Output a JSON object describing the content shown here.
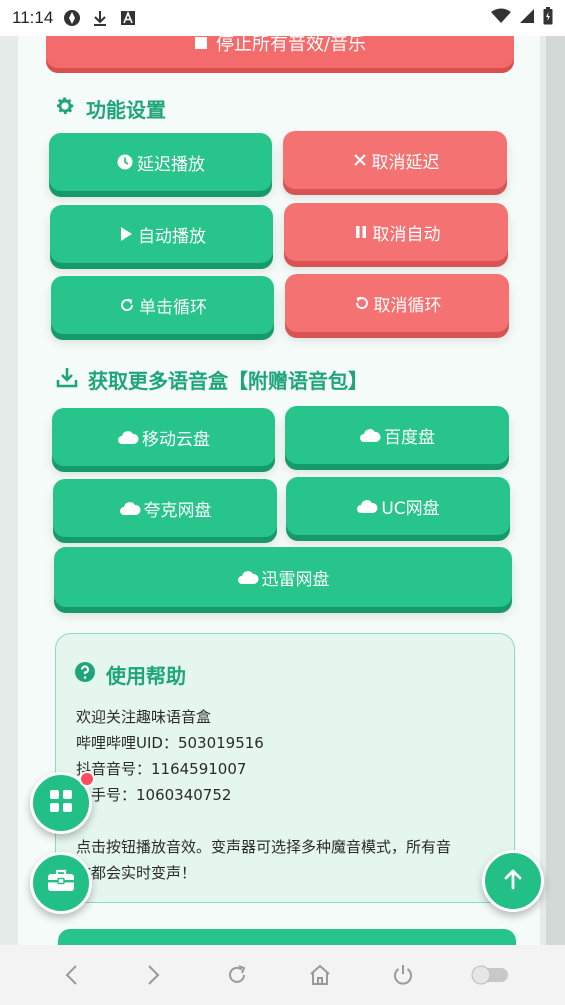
{
  "status_bar": {
    "time": "11:14"
  },
  "top_button": {
    "label": "停止所有音效/音乐"
  },
  "func_section": {
    "title": "功能设置",
    "buttons": [
      {
        "label": "延迟播放"
      },
      {
        "label": "取消延迟"
      },
      {
        "label": "自动播放"
      },
      {
        "label": "取消自动"
      },
      {
        "label": "单击循环"
      },
      {
        "label": "取消循环"
      }
    ]
  },
  "more_section": {
    "title": "获取更多语音盒【附赠语音包】",
    "buttons": [
      {
        "label": "移动云盘"
      },
      {
        "label": "百度盘"
      },
      {
        "label": "夸克网盘"
      },
      {
        "label": "UC网盘"
      },
      {
        "label": "迅雷网盘"
      }
    ]
  },
  "help": {
    "title": "使用帮助",
    "lines": [
      "欢迎关注趣味语音盒",
      "哔哩哔哩UID：503019516",
      "抖音音号：1164591007",
      "快手号：1060340752",
      "点击按钮播放音效。变声器可选择多种魔音模式，所有音",
      "效都会实时变声！"
    ]
  },
  "colors": {
    "green": "#27c48b",
    "red": "#f57272",
    "accent": "#1ea57a"
  }
}
